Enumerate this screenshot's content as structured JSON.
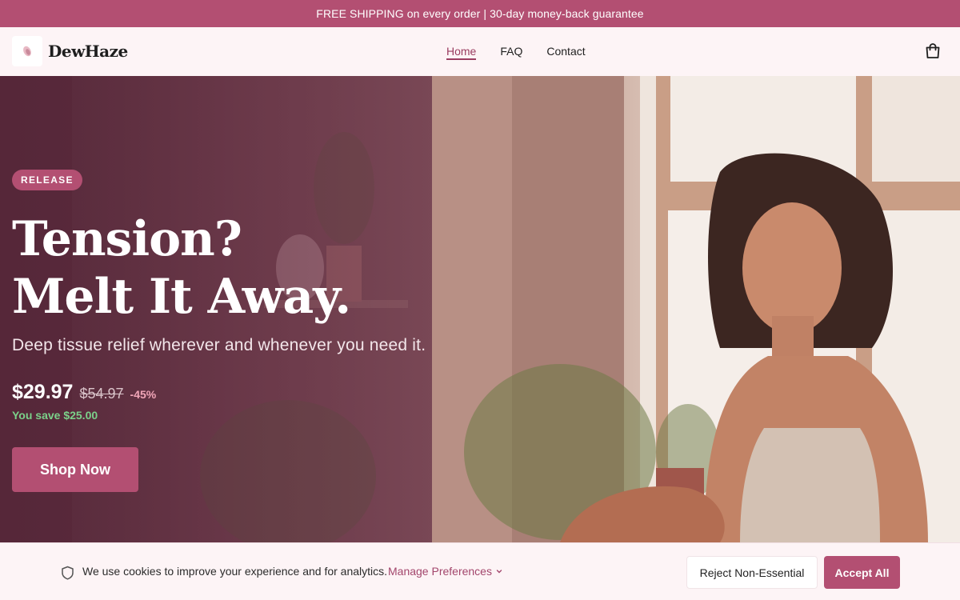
{
  "announcement": {
    "text": "FREE SHIPPING on every order | 30-day money-back guarantee"
  },
  "header": {
    "brand": "DewHaze",
    "nav": [
      {
        "label": "Home",
        "active": true
      },
      {
        "label": "FAQ",
        "active": false
      },
      {
        "label": "Contact",
        "active": false
      }
    ],
    "cart_icon": "shopping-bag-icon"
  },
  "hero": {
    "badge": "RELEASE",
    "headline_line1": "Tension?",
    "headline_line2": "Melt It Away.",
    "subheadline": "Deep tissue relief wherever and whenever you need it.",
    "price": "$29.97",
    "old_price": "$54.97",
    "discount": "-45%",
    "savings": "You save $25.00",
    "cta": "Shop Now"
  },
  "cookie_banner": {
    "icon": "shield-icon",
    "message": "We use cookies to improve your experience and for analytics.",
    "manage_label": "Manage Preferences",
    "reject_label": "Reject Non-Essential",
    "accept_label": "Accept All"
  },
  "colors": {
    "accent": "#b34f72",
    "background": "#fdf4f6",
    "savings_green": "#7bd18a"
  }
}
